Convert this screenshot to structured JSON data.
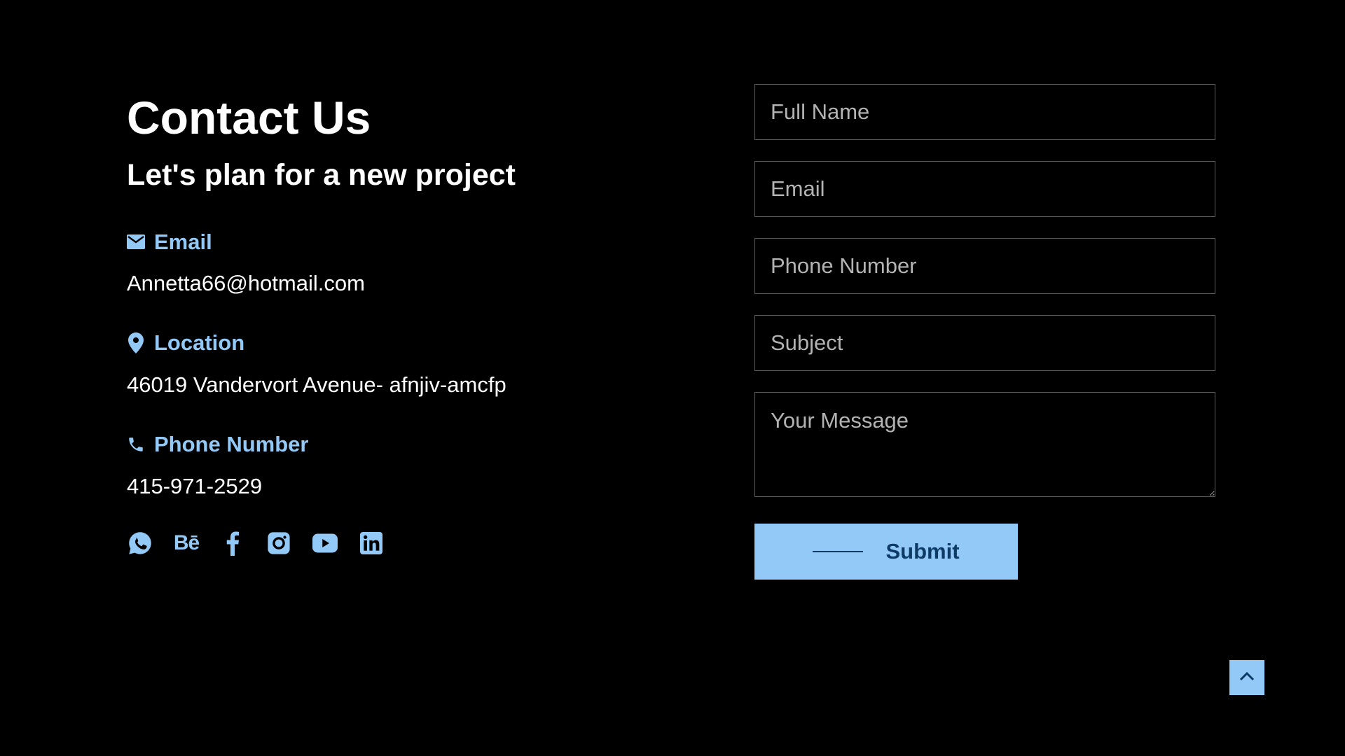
{
  "heading": {
    "title": "Contact Us",
    "subtitle": "Let's plan for a new project"
  },
  "contact": {
    "email_label": "Email",
    "email_value": "Annetta66@hotmail.com",
    "location_label": "Location",
    "location_value": "46019 Vandervort Avenue- afnjiv-amcfp",
    "phone_label": "Phone Number",
    "phone_value": "415-971-2529",
    "accent_color": "#93c9f7"
  },
  "socials": [
    {
      "icon": "whatsapp-icon"
    },
    {
      "icon": "behance-icon",
      "text": "Bē"
    },
    {
      "icon": "facebook-icon"
    },
    {
      "icon": "instagram-icon"
    },
    {
      "icon": "youtube-icon"
    },
    {
      "icon": "linkedin-icon"
    }
  ],
  "form": {
    "full_name_placeholder": "Full Name",
    "email_placeholder": "Email",
    "phone_placeholder": "Phone Number",
    "subject_placeholder": "Subject",
    "message_placeholder": "Your Message",
    "submit_label": "Submit",
    "submit_bg": "#93c9f7",
    "submit_text_color": "#0e3a66"
  },
  "scroll_top": {
    "icon": "chevron-up-icon"
  }
}
